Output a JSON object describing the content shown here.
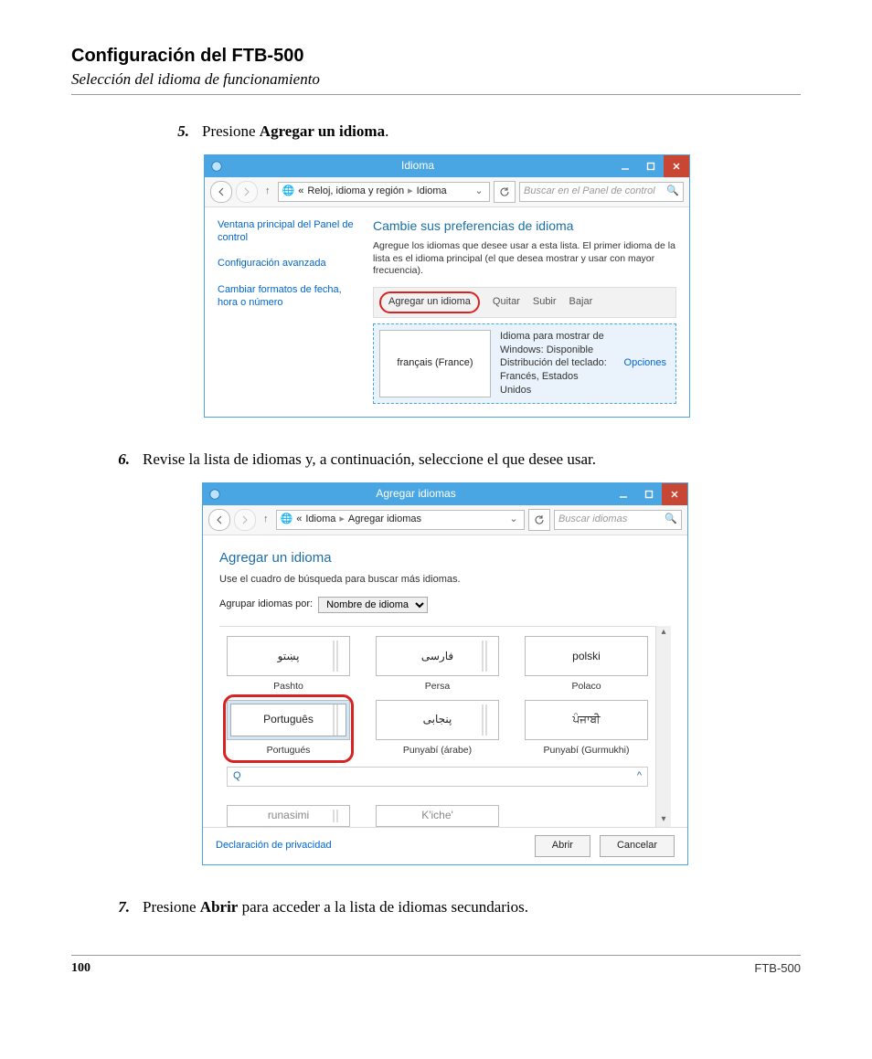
{
  "doc": {
    "title": "Configuración del FTB-500",
    "subtitle": "Selección del idioma de funcionamiento",
    "page_number": "100",
    "model": "FTB-500"
  },
  "steps": {
    "s5": {
      "num": "5.",
      "pre": "Presione ",
      "bold": "Agregar un idioma",
      "post": "."
    },
    "s6": {
      "num": "6.",
      "text": "Revise la lista de idiomas y, a continuación, seleccione el que desee usar."
    },
    "s7": {
      "num": "7.",
      "pre": "Presione ",
      "bold": "Abrir",
      "post": " para acceder a la lista de idiomas secundarios."
    }
  },
  "win1": {
    "title": "Idioma",
    "breadcrumb": {
      "prefix": "«",
      "a": "Reloj, idioma y región",
      "b": "Idioma"
    },
    "search_placeholder": "Buscar en el Panel de control",
    "side": {
      "link1": "Ventana principal del Panel de control",
      "link2": "Configuración avanzada",
      "link3": "Cambiar formatos de fecha, hora o número"
    },
    "heading": "Cambie sus preferencias de idioma",
    "desc": "Agregue los idiomas que desee usar a esta lista. El primer idioma de la lista es el idioma principal (el que desea mostrar y usar con mayor frecuencia).",
    "toolbar": {
      "add": "Agregar un idioma",
      "remove": "Quitar",
      "up": "Subir",
      "down": "Bajar"
    },
    "row": {
      "name": "français (France)",
      "info1": "Idioma para mostrar de Windows: Disponible",
      "info2": "Distribución del teclado: Francés, Estados Unidos",
      "options": "Opciones"
    }
  },
  "win2": {
    "title": "Agregar idiomas",
    "breadcrumb": {
      "prefix": "«",
      "a": "Idioma",
      "b": "Agregar idiomas"
    },
    "search_placeholder": "Buscar idiomas",
    "heading": "Agregar un idioma",
    "desc": "Use el cuadro de búsqueda para buscar más idiomas.",
    "group_label": "Agrupar idiomas por:",
    "group_value": "Nombre de idioma",
    "tiles": {
      "t1": {
        "native": "پښتو",
        "cap": "Pashto"
      },
      "t2": {
        "native": "فارسى",
        "cap": "Persa"
      },
      "t3": {
        "native": "polski",
        "cap": "Polaco"
      },
      "t4": {
        "native": "Português",
        "cap": "Portugués"
      },
      "t5": {
        "native": "پنجابی",
        "cap": "Punyabí (árabe)"
      },
      "t6": {
        "native": "ਪੰਜਾਬੀ",
        "cap": "Punyabí (Gurmukhi)"
      },
      "t7": {
        "native": "runasimi"
      },
      "t8": {
        "native": "K'iche'"
      }
    },
    "letter": {
      "l": "Q",
      "r": "^"
    },
    "privacy": "Declaración de privacidad",
    "open": "Abrir",
    "cancel": "Cancelar"
  }
}
